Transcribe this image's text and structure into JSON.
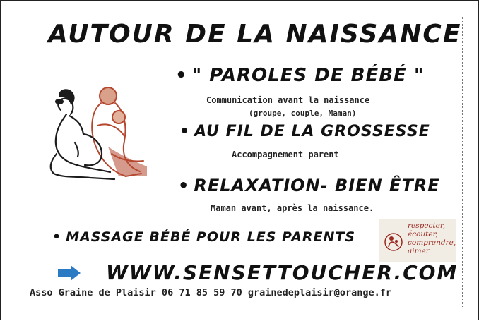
{
  "title": "AUTOUR DE LA NAISSANCE",
  "sections": [
    {
      "heading": "\" PAROLES DE BÉBÉ \"",
      "lines": [
        "Communication avant la naissance",
        "(groupe, couple, Maman)"
      ]
    },
    {
      "heading": "AU FIL DE LA GROSSESSE",
      "lines": [
        "Accompagnement parent"
      ]
    },
    {
      "heading": "RELAXATION- BIEN ÊTRE",
      "lines": [
        "Maman avant, après la naissance."
      ]
    },
    {
      "heading": "MASSAGE BÉBÉ POUR LES PARENTS",
      "lines": []
    }
  ],
  "stamp": {
    "lines": [
      "respecter,",
      "écouter,",
      "comprendre,",
      "aimer"
    ]
  },
  "website": "WWW.SENSETTOUCHER.COM",
  "footer": "Asso Graine de Plaisir 06 71 85 59 70 grainedeplaisir@orange.fr",
  "bullet": "•",
  "colors": {
    "arrow": "#2b7bc4",
    "stamp_text": "#9a2a20",
    "illustration_red": "#b5472f"
  },
  "icons": [
    "arrow-right-icon",
    "mother-baby-illustration",
    "logo-icon"
  ]
}
